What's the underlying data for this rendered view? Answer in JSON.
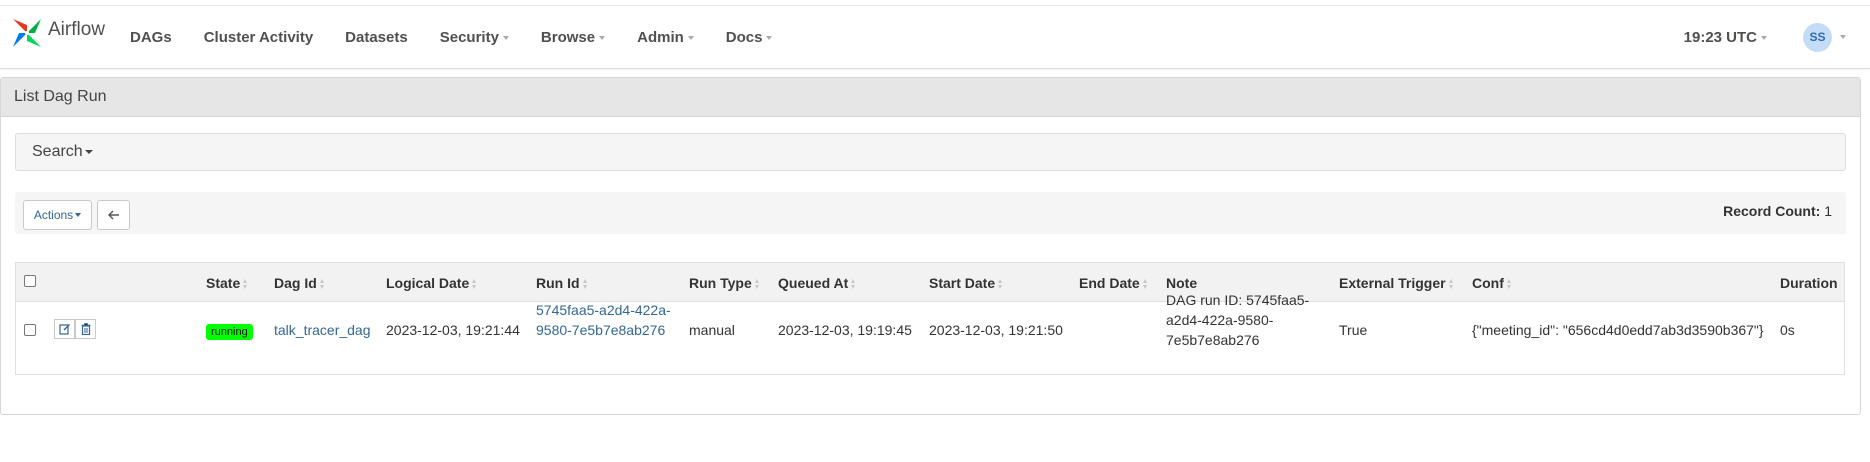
{
  "brand": {
    "name": "Airflow"
  },
  "nav": {
    "items": [
      {
        "label": "DAGs",
        "dropdown": false
      },
      {
        "label": "Cluster Activity",
        "dropdown": false
      },
      {
        "label": "Datasets",
        "dropdown": false
      },
      {
        "label": "Security",
        "dropdown": true
      },
      {
        "label": "Browse",
        "dropdown": true
      },
      {
        "label": "Admin",
        "dropdown": true
      },
      {
        "label": "Docs",
        "dropdown": true
      }
    ],
    "clock": "19:23 UTC",
    "user_initials": "SS"
  },
  "panel": {
    "title": "List Dag Run",
    "search_label": "Search",
    "actions_label": "Actions",
    "record_count_label": "Record Count:",
    "record_count": "1"
  },
  "table": {
    "headers": {
      "state": "State",
      "dag_id": "Dag Id",
      "logical_date": "Logical Date",
      "run_id": "Run Id",
      "run_type": "Run Type",
      "queued_at": "Queued At",
      "start_date": "Start Date",
      "end_date": "End Date",
      "note": "Note",
      "external_trigger": "External Trigger",
      "conf": "Conf",
      "duration": "Duration"
    },
    "rows": [
      {
        "state": "running",
        "dag_id": "talk_tracer_dag",
        "logical_date": "2023-12-03, 19:21:44",
        "run_id_line1": "5745faa5-a2d4-422a-",
        "run_id_line2": "9580-7e5b7e8ab276",
        "run_type": "manual",
        "queued_at": "2023-12-03, 19:19:45",
        "start_date": "2023-12-03, 19:21:50",
        "end_date": "",
        "note_line1": "DAG run ID: 5745faa5-",
        "note_line2": "a2d4-422a-9580-",
        "note_line3": "7e5b7e8ab276",
        "external_trigger": "True",
        "conf": "{\"meeting_id\": \"656cd4d0edd7ab3d3590b367\"}",
        "duration": "0s"
      }
    ]
  },
  "colors": {
    "state_running": "#00ff00",
    "link": "#336699",
    "logo_red": "#e43921",
    "logo_green": "#00ad46",
    "logo_blue": "#017cee",
    "logo_teal": "#04d659"
  },
  "icons": [
    "airflow-logo-icon",
    "edit-icon",
    "trash-icon",
    "arrow-left-icon"
  ]
}
